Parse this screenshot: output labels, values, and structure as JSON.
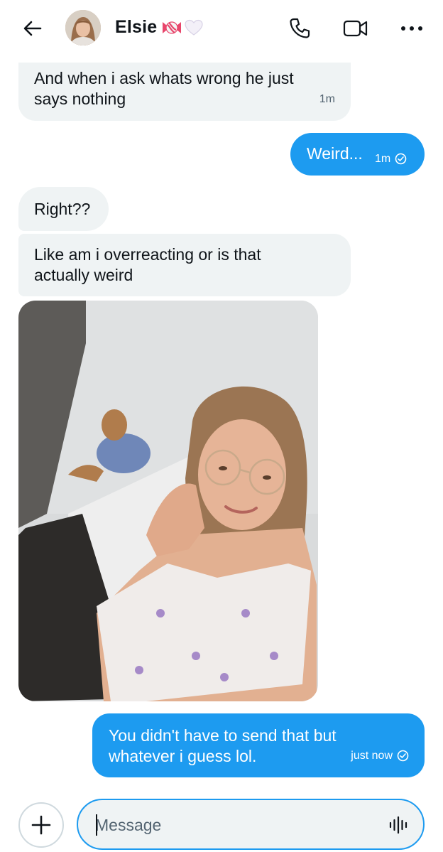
{
  "header": {
    "contact_name": "Elsie",
    "name_emojis": [
      "candy-icon",
      "white-heart-icon"
    ],
    "accent_color": "#1d9bf0"
  },
  "messages": [
    {
      "type": "received",
      "text_line1": "And when i ask whats wrong he just",
      "text_line2": "says nothing",
      "time": "1m"
    },
    {
      "type": "sent",
      "text": "Weird...",
      "time": "1m",
      "status": "read"
    },
    {
      "type": "received",
      "text": "Right??"
    },
    {
      "type": "received",
      "text_line1": "Like am i overreacting or is that",
      "text_line2": "actually weird"
    },
    {
      "type": "image",
      "icon": "photo-selfie"
    },
    {
      "type": "sent",
      "text_line1": "You didn't have to send that but",
      "text_line2": "whatever i guess lol.",
      "time": "just now",
      "status": "read"
    }
  ],
  "composer": {
    "placeholder": "Message"
  }
}
